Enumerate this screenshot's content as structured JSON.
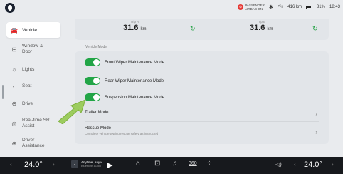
{
  "status": {
    "airbag_line1": "PASSENGER",
    "airbag_line2": "AIRBAG ON",
    "bluetooth": "✱",
    "signal": "⁴ᴳıl",
    "range": "416 km",
    "battery": "81%",
    "time": "18:43"
  },
  "sidebar": {
    "items": [
      {
        "label": "Vehicle",
        "icon": "car-icon",
        "glyph": "🚘"
      },
      {
        "label": "Window & Door",
        "icon": "window-icon",
        "glyph": "⊟"
      },
      {
        "label": "Lights",
        "icon": "light-icon",
        "glyph": "☼"
      },
      {
        "label": "Seat",
        "icon": "seat-icon",
        "glyph": "⌐"
      },
      {
        "label": "Drive",
        "icon": "steering-wheel-icon",
        "glyph": "⊖"
      },
      {
        "label": "Real-time SR Assist",
        "icon": "sr-assist-icon",
        "glyph": "◎"
      },
      {
        "label": "Driver Assistance",
        "icon": "driver-assist-icon",
        "glyph": "⊕"
      }
    ]
  },
  "trip": {
    "a_label": "Trip A",
    "a_value": "31.6",
    "a_unit": "km",
    "b_label": "Trip B",
    "b_value": "31.6",
    "b_unit": "km",
    "refresh_glyph": "↻"
  },
  "vehicle_mode": {
    "section_label": "Vehicle Mode",
    "toggles": [
      {
        "label": "Front Wiper Maintenance Mode",
        "on": true
      },
      {
        "label": "Rear Wiper Maintenance Mode",
        "on": true
      },
      {
        "label": "Suspension Maintenance Mode",
        "on": true
      }
    ],
    "trailer_label": "Trailer Mode",
    "rescue_label": "Rescue Mode",
    "rescue_desc": "Complete vehicle towing rescue safely as instructed",
    "chevron": "›",
    "accent_color": "#22a547"
  },
  "bottombar": {
    "left_temp": "24.0°",
    "right_temp": "24.0°",
    "chev_left": "‹",
    "chev_right": "›",
    "song_title": "Anytime, Anyw...",
    "song_sub": "Bluetooth Audio",
    "play_glyph": "▶",
    "home_glyph": "⌂",
    "car_glyph": "⊡",
    "music_glyph": "♫",
    "view360": "360",
    "apps_glyph": "⁘",
    "volume_glyph": "◁)"
  }
}
